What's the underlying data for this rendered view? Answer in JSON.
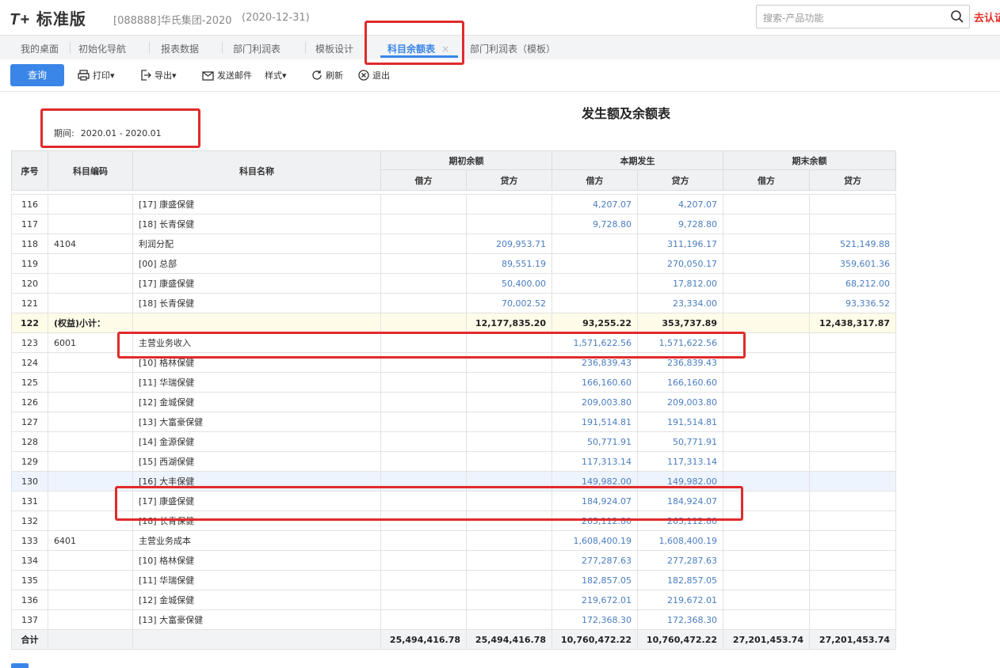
{
  "app": {
    "logo_prefix": "T+",
    "logo_text": "标准版",
    "account": "[088888]华氏集团-2020",
    "date": "(2020-12-31)"
  },
  "search": {
    "placeholder": "搜索-产品功能"
  },
  "goto_label": "去认证",
  "tabs": [
    {
      "label": "我的桌面"
    },
    {
      "label": "初始化导航"
    },
    {
      "label": "报表数据"
    },
    {
      "label": "部门利润表"
    },
    {
      "label": "模板设计"
    },
    {
      "label": "科目余额表",
      "active": true
    },
    {
      "label": "部门利润表（模板）"
    }
  ],
  "toolbar": {
    "query": "查询",
    "print": "打印",
    "export": "导出",
    "email": "发送邮件",
    "style": "样式",
    "refresh": "刷新",
    "exit": "退出"
  },
  "report": {
    "title": "发生额及余额表",
    "period_label": "期间:",
    "period_value": "2020.01 - 2020.01"
  },
  "columns": {
    "seq": "序号",
    "code": "科目编码",
    "name": "科目名称",
    "opening": "期初余额",
    "current": "本期发生",
    "closing": "期末余额",
    "debit": "借方",
    "credit": "贷方"
  },
  "rows": [
    [
      "116",
      "",
      "[17] 康盛保健",
      "",
      "",
      "4,207.07",
      "4,207.07",
      "",
      ""
    ],
    [
      "117",
      "",
      "[18] 长青保健",
      "",
      "",
      "9,728.80",
      "9,728.80",
      "",
      ""
    ],
    [
      "118",
      "4104",
      "利润分配",
      "",
      "209,953.71",
      "",
      "311,196.17",
      "",
      "521,149.88"
    ],
    [
      "119",
      "",
      "[00] 总部",
      "",
      "89,551.19",
      "",
      "270,050.17",
      "",
      "359,601.36"
    ],
    [
      "120",
      "",
      "[17] 康盛保健",
      "",
      "50,400.00",
      "",
      "17,812.00",
      "",
      "68,212.00"
    ],
    [
      "121",
      "",
      "[18] 长青保健",
      "",
      "70,002.52",
      "",
      "23,334.00",
      "",
      "93,336.52"
    ],
    [
      "122",
      "(权益)小计：",
      "",
      "",
      "12,177,835.20",
      "93,255.22",
      "353,737.89",
      "",
      "12,438,317.87"
    ],
    [
      "123",
      "6001",
      "主营业务收入",
      "",
      "",
      "1,571,622.56",
      "1,571,622.56",
      "",
      ""
    ],
    [
      "124",
      "",
      "[10] 格林保健",
      "",
      "",
      "236,839.43",
      "236,839.43",
      "",
      ""
    ],
    [
      "125",
      "",
      "[11] 华瑞保健",
      "",
      "",
      "166,160.60",
      "166,160.60",
      "",
      ""
    ],
    [
      "126",
      "",
      "[12] 金城保健",
      "",
      "",
      "209,003.80",
      "209,003.80",
      "",
      ""
    ],
    [
      "127",
      "",
      "[13] 大富豪保健",
      "",
      "",
      "191,514.81",
      "191,514.81",
      "",
      ""
    ],
    [
      "128",
      "",
      "[14] 金源保健",
      "",
      "",
      "50,771.91",
      "50,771.91",
      "",
      ""
    ],
    [
      "129",
      "",
      "[15] 西湖保健",
      "",
      "",
      "117,313.14",
      "117,313.14",
      "",
      ""
    ],
    [
      "130",
      "",
      "[16] 大丰保健",
      "",
      "",
      "149,982.00",
      "149,982.00",
      "",
      ""
    ],
    [
      "131",
      "",
      "[17] 康盛保健",
      "",
      "",
      "184,924.07",
      "184,924.07",
      "",
      ""
    ],
    [
      "132",
      "",
      "[18] 长青保健",
      "",
      "",
      "265,112.80",
      "265,112.80",
      "",
      ""
    ],
    [
      "133",
      "6401",
      "主营业务成本",
      "",
      "",
      "1,608,400.19",
      "1,608,400.19",
      "",
      ""
    ],
    [
      "134",
      "",
      "[10] 格林保健",
      "",
      "",
      "277,287.63",
      "277,287.63",
      "",
      ""
    ],
    [
      "135",
      "",
      "[11] 华瑞保健",
      "",
      "",
      "182,857.05",
      "182,857.05",
      "",
      ""
    ],
    [
      "136",
      "",
      "[12] 金城保健",
      "",
      "",
      "219,672.01",
      "219,672.01",
      "",
      ""
    ],
    [
      "137",
      "",
      "[13] 大富豪保健",
      "",
      "",
      "172,368.30",
      "172,368.30",
      "",
      ""
    ]
  ],
  "totals": [
    "合计",
    "",
    "",
    "25,494,416.78",
    "25,494,416.78",
    "10,760,472.22",
    "10,760,472.22",
    "27,201,453.74",
    "27,201,453.74"
  ],
  "colors": {
    "accent": "#3a86e8",
    "highlight_box": "#e02b2b",
    "subtotal_bg": "#fefbe8"
  }
}
